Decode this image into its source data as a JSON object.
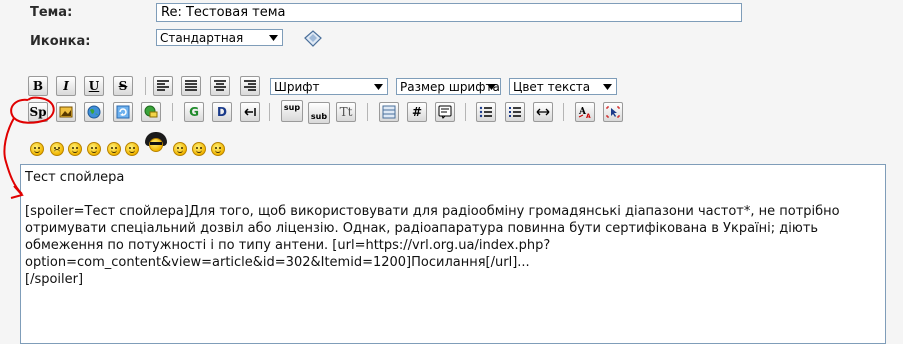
{
  "form": {
    "subject_label": "Тема:",
    "subject_value": "Re: Тестовая тема",
    "icon_label": "Иконка:",
    "icon_select_value": "Стандартная"
  },
  "toolbar": {
    "row1": {
      "bold": "B",
      "italic": "I",
      "underline": "U",
      "strike": "S",
      "font_select": "Шрифт",
      "size_select": "Размер шрифта",
      "color_select": "Цвет текста"
    },
    "row2": {
      "spoiler": "Sp",
      "google": "G",
      "d_button": "D",
      "sup": "sup",
      "sub": "sub",
      "tt": "Tt",
      "hash": "#"
    }
  },
  "smilies": [
    "smile-cool-icon",
    "smile-sad-icon",
    "smile-angry-icon",
    "smile-glasses-icon",
    "smile-wink-icon",
    "smile-tongue-icon",
    "smile-afro-icon",
    "smile-grin-icon",
    "smile-laugh-icon",
    "smile-happy-icon"
  ],
  "editor": {
    "content": "Тест спойлера\n\n[spoiler=Тест спойлера]Для того, щоб використовувати для радіообміну громадянські діапазони частот*, не потрібно отримувати спеціальний дозвіл або ліцензію. Однак, радіоапаратура повинна бути сертифікована в Україні; діють обмеження по потужності і по типу антени. [url=https://vrl.org.ua/index.php?option=com_content&view=article&id=302&Itemid=1200]Посилання[/url]...\n[/spoiler]"
  },
  "colors": {
    "annotation": "#e00000",
    "border": "#7f9db9",
    "background": "#f5f5f5"
  }
}
